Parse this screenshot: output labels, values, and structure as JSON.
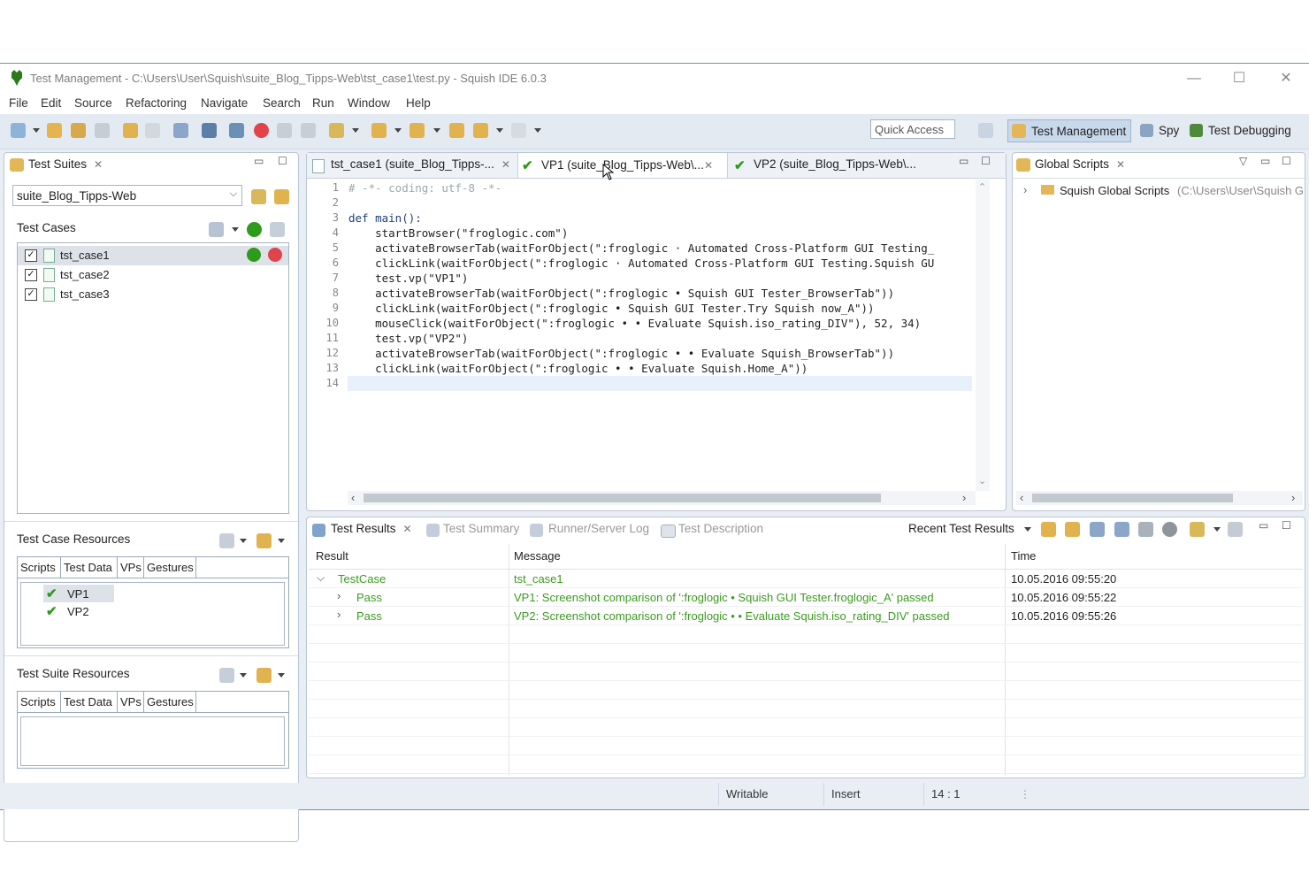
{
  "window": {
    "title": "Test Management - C:\\Users\\User\\Squish\\suite_Blog_Tipps-Web\\tst_case1\\test.py - Squish IDE 6.0.3",
    "controls": {
      "minimize": "—",
      "maximize": "☐",
      "close": "✕"
    }
  },
  "menu": [
    "File",
    "Edit",
    "Source",
    "Refactoring",
    "Navigate",
    "Search",
    "Run",
    "Window",
    "Help"
  ],
  "toolbar": {
    "quick_access": "Quick Access",
    "perspectives": [
      "Test Management",
      "Spy",
      "Test Debugging"
    ]
  },
  "test_suites": {
    "tab": "Test Suites",
    "suite_select": "suite_Blog_Tipps-Web",
    "test_cases_label": "Test Cases",
    "cases": [
      {
        "name": "tst_case1",
        "checked": true,
        "selected": true
      },
      {
        "name": "tst_case2",
        "checked": true,
        "selected": false
      },
      {
        "name": "tst_case3",
        "checked": true,
        "selected": false
      }
    ],
    "case_resources_label": "Test Case Resources",
    "suite_resources_label": "Test Suite Resources",
    "resource_tabs": [
      "Scripts",
      "Test Data",
      "VPs",
      "Gestures"
    ],
    "vps": [
      "VP1",
      "VP2"
    ]
  },
  "editor": {
    "tabs": [
      {
        "label": "tst_case1 (suite_Blog_Tipps-...",
        "active": false
      },
      {
        "label": "VP1 (suite_Blog_Tipps-Web\\...",
        "active": true
      },
      {
        "label": "VP2 (suite_Blog_Tipps-Web\\...",
        "active": false
      }
    ],
    "line_numbers": [
      "1",
      "2",
      "3",
      "4",
      "5",
      "6",
      "7",
      "8",
      "9",
      "10",
      "11",
      "12",
      "13",
      "14"
    ],
    "lines": [
      "# -*- coding: utf-8 -*-",
      "",
      "def main():",
      "    startBrowser(\"froglogic.com\")",
      "    activateBrowserTab(waitForObject(\":froglogic · Automated Cross-Platform GUI Testing_",
      "    clickLink(waitForObject(\":froglogic · Automated Cross-Platform GUI Testing.Squish GU",
      "    test.vp(\"VP1\")",
      "    activateBrowserTab(waitForObject(\":froglogic • Squish GUI Tester_BrowserTab\"))",
      "    clickLink(waitForObject(\":froglogic • Squish GUI Tester.Try Squish now_A\"))",
      "    mouseClick(waitForObject(\":froglogic • • Evaluate Squish.iso_rating_DIV\"), 52, 34)",
      "    test.vp(\"VP2\")",
      "    activateBrowserTab(waitForObject(\":froglogic • • Evaluate Squish_BrowserTab\"))",
      "    clickLink(waitForObject(\":froglogic • • Evaluate Squish.Home_A\"))",
      ""
    ]
  },
  "global_scripts": {
    "tab": "Global Scripts",
    "root_label": "Squish Global Scripts",
    "root_path": "(C:\\Users\\User\\Squish G"
  },
  "results": {
    "tabs": [
      "Test Results",
      "Test Summary",
      "Runner/Server Log",
      "Test Description"
    ],
    "recent_label": "Recent Test Results",
    "columns": [
      "Result",
      "Message",
      "Time"
    ],
    "rows": [
      {
        "result": "TestCase",
        "message": "tst_case1",
        "time": "10.05.2016 09:55:20"
      },
      {
        "result": "Pass",
        "message": "VP1: Screenshot comparison of ':froglogic • Squish GUI Tester.froglogic_A' passed",
        "time": "10.05.2016 09:55:22"
      },
      {
        "result": "Pass",
        "message": "VP2: Screenshot comparison of ':froglogic • • Evaluate Squish.iso_rating_DIV' passed",
        "time": "10.05.2016 09:55:26"
      }
    ]
  },
  "status": {
    "mode": "Writable",
    "insert": "Insert",
    "position": "14 : 1"
  },
  "colors": {
    "accent": "#3a9b1f",
    "toolbar_bg": "#e4eaf2",
    "panel_border": "#b9c6d5"
  }
}
